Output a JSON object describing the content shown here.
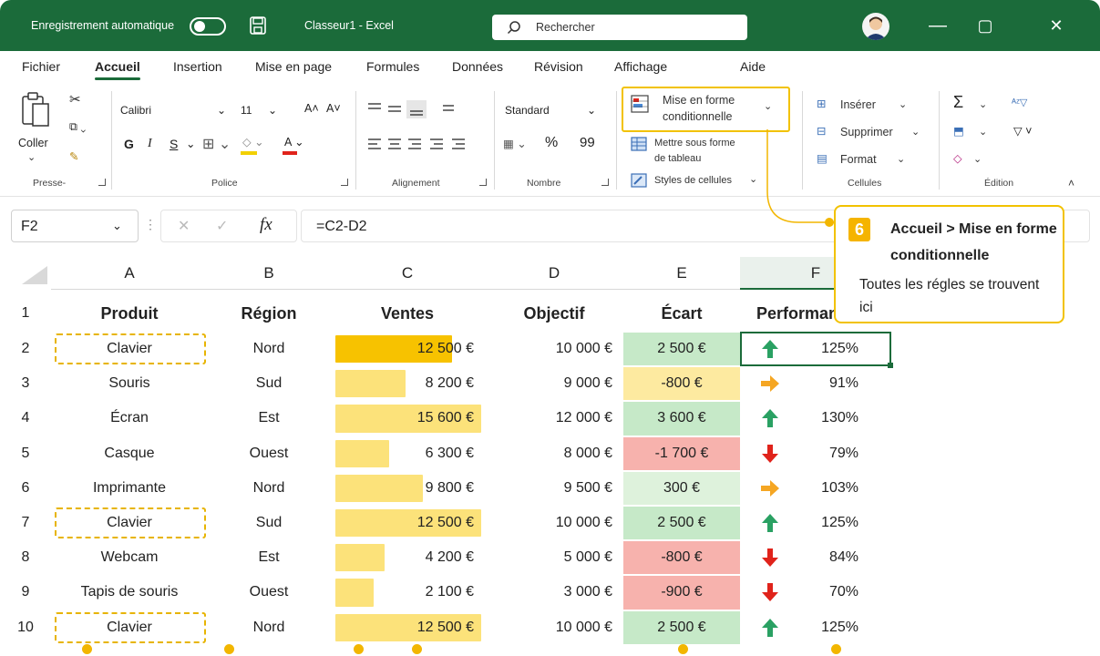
{
  "titlebar": {
    "autosave_label": "Enregistrement automatique",
    "doc_title": "Classeur1  -  Excel",
    "search_placeholder": "Rechercher",
    "minimize": "—",
    "maximize": "▢",
    "close": "✕"
  },
  "tabs": [
    "Fichier",
    "Accueil",
    "Insertion",
    "Mise en page",
    "Formules",
    "Données",
    "Révision",
    "Affichage",
    "Aide"
  ],
  "ribbon": {
    "clipboard": {
      "paste": "Coller",
      "label": "Presse-papiers"
    },
    "font": {
      "name": "Calibri",
      "size": "11",
      "grow": "A˄",
      "shrink": "A˅",
      "bold": "G",
      "italic": "I",
      "underline": "S",
      "label": "Police"
    },
    "alignment": {
      "label": "Alignement"
    },
    "number": {
      "format": "Standard",
      "percent": "%",
      "thousands": "99",
      "label": "Nombre"
    },
    "styles": {
      "conditional_line1": "Mise en forme",
      "conditional_line2": "conditionnelle",
      "table_line1": "Mettre sous forme",
      "table_line2": "de tableau",
      "cell_styles": "Styles de cellules"
    },
    "cells": {
      "insert": "Insérer",
      "delete": "Supprimer",
      "format": "Format",
      "label": "Cellules"
    },
    "editing": {
      "label": "Édition"
    }
  },
  "formula_bar": {
    "name_box": "F2",
    "fx": "fx",
    "formula": "=C2-D2"
  },
  "sheet": {
    "columns": [
      "A",
      "B",
      "C",
      "D",
      "E",
      "F"
    ],
    "headers": [
      "Produit",
      "Région",
      "Ventes",
      "Objectif",
      "Écart",
      "Performan"
    ],
    "rows": [
      {
        "n": "2",
        "produit": "Clavier",
        "region": "Nord",
        "ventes": "12 500 €",
        "objectif": "10 000 €",
        "ecart": "2 500 €",
        "trend": "up",
        "perf": "125%",
        "bar": 0.8,
        "ecart_color": "#c6e9c8"
      },
      {
        "n": "3",
        "produit": "Souris",
        "region": "Sud",
        "ventes": "8 200 €",
        "objectif": "9 000 €",
        "ecart": "-800 €",
        "trend": "flat",
        "perf": "91%",
        "bar": 0.48,
        "ecart_color": "#fdeaa0"
      },
      {
        "n": "4",
        "produit": "Écran",
        "region": "Est",
        "ventes": "15 600 €",
        "objectif": "12 000 €",
        "ecart": "3 600 €",
        "trend": "up",
        "perf": "130%",
        "bar": 1.0,
        "ecart_color": "#c6e9c8"
      },
      {
        "n": "5",
        "produit": "Casque",
        "region": "Ouest",
        "ventes": "6 300 €",
        "objectif": "8 000 €",
        "ecart": "-1 700 €",
        "trend": "down",
        "perf": "79%",
        "bar": 0.37,
        "ecart_color": "#f7b2ad"
      },
      {
        "n": "6",
        "produit": "Imprimante",
        "region": "Nord",
        "ventes": "9 800 €",
        "objectif": "9 500 €",
        "ecart": "300 €",
        "trend": "flat",
        "perf": "103%",
        "bar": 0.6,
        "ecart_color": "#def2dc"
      },
      {
        "n": "7",
        "produit": "Clavier",
        "region": "Sud",
        "ventes": "12 500 €",
        "objectif": "10 000 €",
        "ecart": "2 500 €",
        "trend": "up",
        "perf": "125%",
        "bar": 1.0,
        "ecart_color": "#c6e9c8"
      },
      {
        "n": "8",
        "produit": "Webcam",
        "region": "Est",
        "ventes": "4 200 €",
        "objectif": "5 000 €",
        "ecart": "-800 €",
        "trend": "down",
        "perf": "84%",
        "bar": 0.34,
        "ecart_color": "#f7b2ad"
      },
      {
        "n": "9",
        "produit": "Tapis de souris",
        "region": "Ouest",
        "ventes": "2 100 €",
        "objectif": "3 000 €",
        "ecart": "-900 €",
        "trend": "down",
        "perf": "70%",
        "bar": 0.26,
        "ecart_color": "#f7b2ad"
      },
      {
        "n": "10",
        "produit": "Clavier",
        "region": "Nord",
        "ventes": "12 500 €",
        "objectif": "10 000 €",
        "ecart": "2 500 €",
        "trend": "up",
        "perf": "125%",
        "bar": 1.0,
        "ecart_color": "#c6e9c8"
      }
    ]
  },
  "callout": {
    "step": "6",
    "title": "Accueil > Mise en forme conditionnelle",
    "body": "Toutes les régles se trouvent ici"
  },
  "colors": {
    "excel_green": "#1b6b3a",
    "highlight_yellow": "#f2c200",
    "bar_first": "#f7c200",
    "bar": "#fce27a",
    "arrow_up": "#2aa163",
    "arrow_flat": "#f5a623",
    "arrow_down": "#e0231b"
  }
}
